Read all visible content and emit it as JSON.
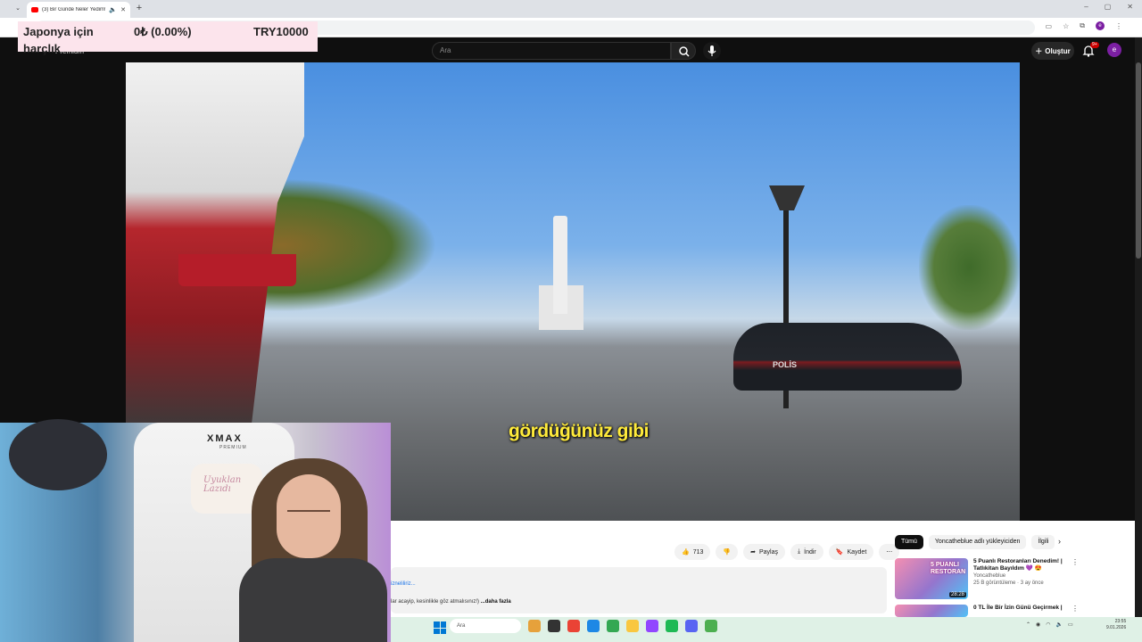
{
  "browser": {
    "tab_title": "(3) Bir Günde Neler Yedim!",
    "new_tab": "+",
    "window_controls": [
      "–",
      "▢",
      "✕"
    ]
  },
  "overlay": {
    "label": "Japonya için harçlık",
    "change": "0₺ (0.00%)",
    "amount": "TRY10000"
  },
  "youtube": {
    "logo_text": "Premium",
    "search_placeholder": "Ara",
    "create_label": "Oluştur",
    "notification_count": "9+",
    "avatar_letter": "e"
  },
  "video": {
    "caption": "gördüğünüz gibi",
    "police_text": "POLİS"
  },
  "actions": {
    "likes": "713",
    "share": "Paylaş",
    "download": "İndir",
    "save": "Kaydet"
  },
  "description": {
    "line1": "izneliliriz...",
    "line2": "lar acayip, kesinlikle göz atmalısınız!)",
    "more": "...daha fazla"
  },
  "sidebar": {
    "filters": [
      "Tümü",
      "Yoncatheblue adlı yükleyiciden",
      "İlgili"
    ],
    "recommendations": [
      {
        "thumb_text": "5 PUANLI RESTORAN",
        "duration": "28:28",
        "title": "5 Puanlı Restoranları Denedim! | Tatlıkitan Bayıldım 💜 😍",
        "channel": "Yoncatheblue",
        "meta": "25 B görüntüleme · 3 ay önce"
      },
      {
        "thumb_text": "",
        "duration": "",
        "title": "0 TL İle Bir İzin Günü Geçirmek |",
        "channel": "",
        "meta": ""
      }
    ]
  },
  "webcam": {
    "chair_brand": "XMAX",
    "chair_sub": "PREMIUM",
    "pillow_text": "Uyuklan Lazıdı"
  },
  "taskbar": {
    "search_placeholder": "Ara",
    "clock_time": "23:55",
    "clock_date": "9.01.2026"
  },
  "colors": {
    "yt_red": "#ff0000",
    "caption_yellow": "#ffeb3b",
    "overlay_pink": "#fce4ec"
  }
}
